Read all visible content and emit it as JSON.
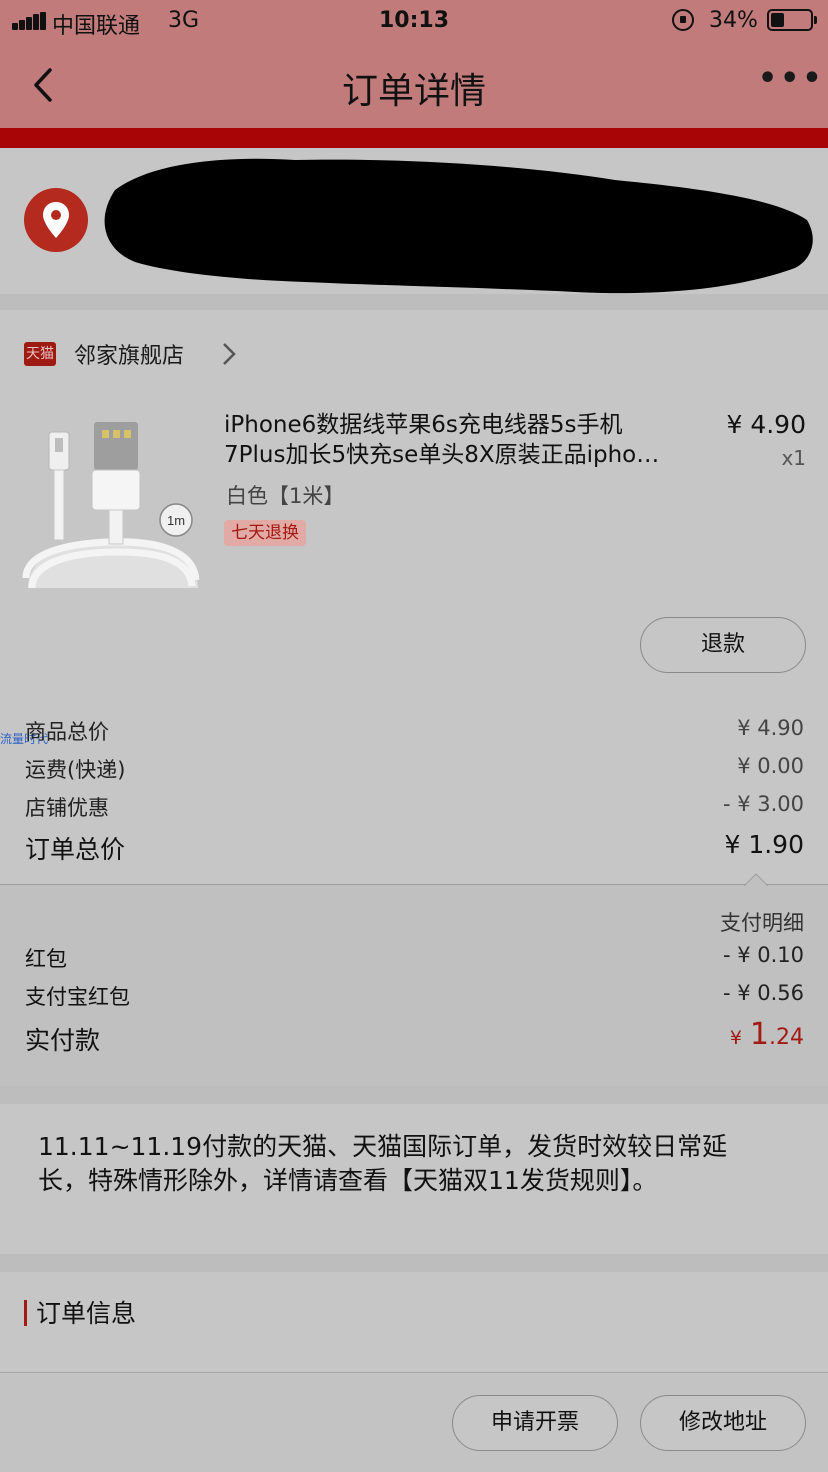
{
  "status_bar": {
    "carrier": "中国联通",
    "network": "3G",
    "time": "10:13",
    "battery": "34%",
    "battery_level": 0.34
  },
  "nav": {
    "title": "订单详情",
    "back_icon": "chevron-left-icon",
    "more_icon": "more-horizontal-icon"
  },
  "address": {
    "icon": "location-pin-icon"
  },
  "store": {
    "badge": "天猫",
    "name": "邻家旗舰店"
  },
  "product": {
    "title_line1": "iPhone6数据线苹果6s充电线器5s手机",
    "title_line2": "7Plus加长5快充se单头8X原装正品ipho…",
    "sku": "白色【1米】",
    "tag": "七天退换",
    "price": "¥ 4.90",
    "quantity": "x1",
    "image_label": "1m",
    "refund_label": "退款"
  },
  "summary": {
    "rows": [
      {
        "label": "商品总价",
        "value": "¥ 4.90"
      },
      {
        "label": "运费(快递)",
        "value": "¥ 0.00"
      },
      {
        "label": "店铺优惠",
        "value": "- ¥ 3.00"
      }
    ],
    "total_label": "订单总价",
    "total_value": "¥ 1.90",
    "watermark": "流量时代"
  },
  "payment": {
    "detail_label": "支付明细",
    "rows": [
      {
        "label": "红包",
        "value": "- ¥ 0.10"
      },
      {
        "label": "支付宝红包",
        "value": "- ¥ 0.56"
      }
    ],
    "actual_label": "实付款",
    "actual_symbol": "¥",
    "actual_int": "1",
    "actual_dec": ".24",
    "accent": "#a31a14"
  },
  "notice": {
    "text": "11.11~11.19付款的天猫、天猫国际订单，发货时效较日常延长，特殊情形除外，详情请查看【天猫双11发货规则】。"
  },
  "order_info": {
    "title": "订单信息"
  },
  "bottom": {
    "invoice_label": "申请开票",
    "change_address_label": "修改地址"
  }
}
